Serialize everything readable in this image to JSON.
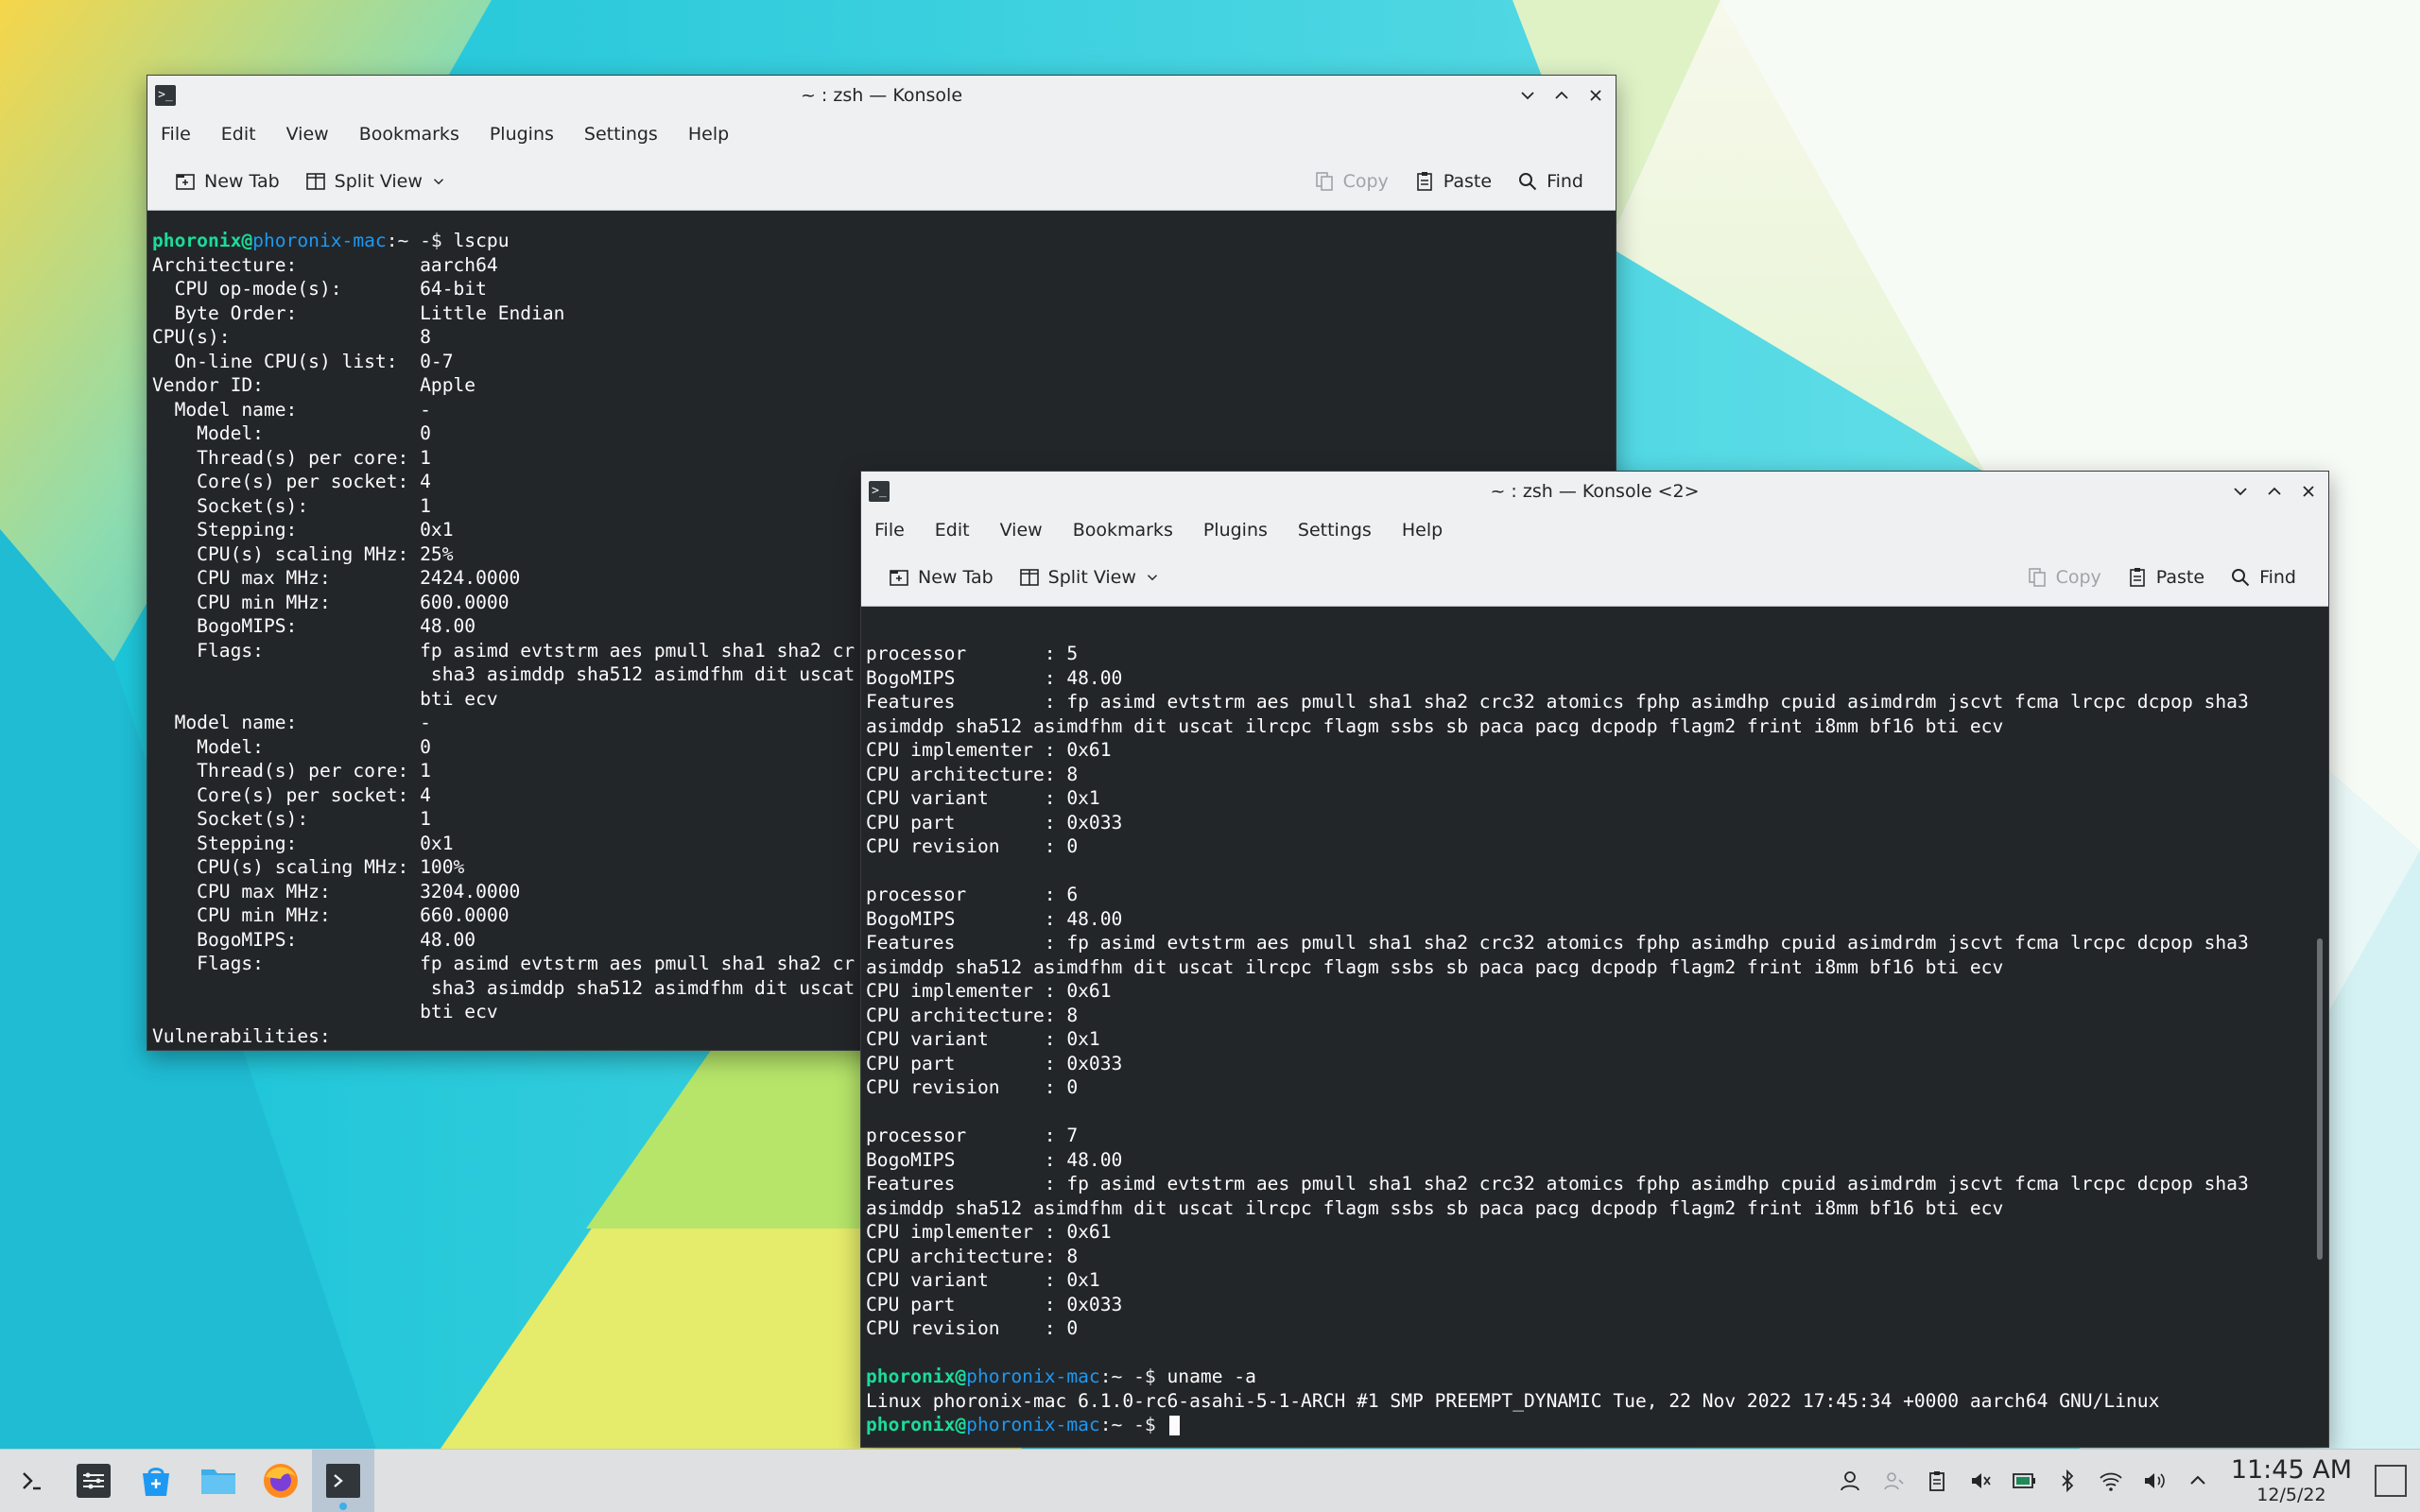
{
  "window1": {
    "title": "~ : zsh — Konsole",
    "menu": [
      "File",
      "Edit",
      "View",
      "Bookmarks",
      "Plugins",
      "Settings",
      "Help"
    ],
    "toolbar": {
      "new_tab": "New Tab",
      "split_view": "Split View",
      "copy": "Copy",
      "paste": "Paste",
      "find": "Find"
    },
    "lines": [
      {
        "prompt": true,
        "user": "phoronix",
        "host": "phoronix-mac",
        "dir": "~",
        "sym": " -$ ",
        "cmd": "lscpu"
      },
      {
        "text": "Architecture:           aarch64"
      },
      {
        "text": "  CPU op-mode(s):       64-bit"
      },
      {
        "text": "  Byte Order:           Little Endian"
      },
      {
        "text": "CPU(s):                 8"
      },
      {
        "text": "  On-line CPU(s) list:  0-7"
      },
      {
        "text": "Vendor ID:              Apple"
      },
      {
        "text": "  Model name:           -"
      },
      {
        "text": "    Model:              0"
      },
      {
        "text": "    Thread(s) per core: 1"
      },
      {
        "text": "    Core(s) per socket: 4"
      },
      {
        "text": "    Socket(s):          1"
      },
      {
        "text": "    Stepping:           0x1"
      },
      {
        "text": "    CPU(s) scaling MHz: 25%"
      },
      {
        "text": "    CPU max MHz:        2424.0000"
      },
      {
        "text": "    CPU min MHz:        600.0000"
      },
      {
        "text": "    BogoMIPS:           48.00"
      },
      {
        "text": "    Flags:              fp asimd evtstrm aes pmull sha1 sha2 cr"
      },
      {
        "text": "                         sha3 asimddp sha512 asimdfhm dit uscat"
      },
      {
        "text": "                        bti ecv"
      },
      {
        "text": "  Model name:           -"
      },
      {
        "text": "    Model:              0"
      },
      {
        "text": "    Thread(s) per core: 1"
      },
      {
        "text": "    Core(s) per socket: 4"
      },
      {
        "text": "    Socket(s):          1"
      },
      {
        "text": "    Stepping:           0x1"
      },
      {
        "text": "    CPU(s) scaling MHz: 100%"
      },
      {
        "text": "    CPU max MHz:        3204.0000"
      },
      {
        "text": "    CPU min MHz:        660.0000"
      },
      {
        "text": "    BogoMIPS:           48.00"
      },
      {
        "text": "    Flags:              fp asimd evtstrm aes pmull sha1 sha2 cr"
      },
      {
        "text": "                         sha3 asimddp sha512 asimdfhm dit uscat"
      },
      {
        "text": "                        bti ecv"
      },
      {
        "text": "Vulnerabilities:"
      }
    ]
  },
  "window2": {
    "title": "~ : zsh — Konsole <2>",
    "menu": [
      "File",
      "Edit",
      "View",
      "Bookmarks",
      "Plugins",
      "Settings",
      "Help"
    ],
    "toolbar": {
      "new_tab": "New Tab",
      "split_view": "Split View",
      "copy": "Copy",
      "paste": "Paste",
      "find": "Find"
    },
    "lines": [
      {
        "text": "processor       : 5"
      },
      {
        "text": "BogoMIPS        : 48.00"
      },
      {
        "text": "Features        : fp asimd evtstrm aes pmull sha1 sha2 crc32 atomics fphp asimdhp cpuid asimdrdm jscvt fcma lrcpc dcpop sha3"
      },
      {
        "text": "asimddp sha512 asimdfhm dit uscat ilrcpc flagm ssbs sb paca pacg dcpodp flagm2 frint i8mm bf16 bti ecv"
      },
      {
        "text": "CPU implementer : 0x61"
      },
      {
        "text": "CPU architecture: 8"
      },
      {
        "text": "CPU variant     : 0x1"
      },
      {
        "text": "CPU part        : 0x033"
      },
      {
        "text": "CPU revision    : 0"
      },
      {
        "text": ""
      },
      {
        "text": "processor       : 6"
      },
      {
        "text": "BogoMIPS        : 48.00"
      },
      {
        "text": "Features        : fp asimd evtstrm aes pmull sha1 sha2 crc32 atomics fphp asimdhp cpuid asimdrdm jscvt fcma lrcpc dcpop sha3"
      },
      {
        "text": "asimddp sha512 asimdfhm dit uscat ilrcpc flagm ssbs sb paca pacg dcpodp flagm2 frint i8mm bf16 bti ecv"
      },
      {
        "text": "CPU implementer : 0x61"
      },
      {
        "text": "CPU architecture: 8"
      },
      {
        "text": "CPU variant     : 0x1"
      },
      {
        "text": "CPU part        : 0x033"
      },
      {
        "text": "CPU revision    : 0"
      },
      {
        "text": ""
      },
      {
        "text": "processor       : 7"
      },
      {
        "text": "BogoMIPS        : 48.00"
      },
      {
        "text": "Features        : fp asimd evtstrm aes pmull sha1 sha2 crc32 atomics fphp asimdhp cpuid asimdrdm jscvt fcma lrcpc dcpop sha3"
      },
      {
        "text": "asimddp sha512 asimdfhm dit uscat ilrcpc flagm ssbs sb paca pacg dcpodp flagm2 frint i8mm bf16 bti ecv"
      },
      {
        "text": "CPU implementer : 0x61"
      },
      {
        "text": "CPU architecture: 8"
      },
      {
        "text": "CPU variant     : 0x1"
      },
      {
        "text": "CPU part        : 0x033"
      },
      {
        "text": "CPU revision    : 0"
      },
      {
        "text": ""
      },
      {
        "prompt": true,
        "user": "phoronix",
        "host": "phoronix-mac",
        "dir": "~",
        "sym": " -$ ",
        "cmd": "uname -a"
      },
      {
        "text": "Linux phoronix-mac 6.1.0-rc6-asahi-5-1-ARCH #1 SMP PREEMPT_DYNAMIC Tue, 22 Nov 2022 17:45:34 +0000 aarch64 GNU/Linux"
      },
      {
        "prompt": true,
        "user": "phoronix",
        "host": "phoronix-mac",
        "dir": "~",
        "sym": " -$ ",
        "cmd": "",
        "cursor": true
      }
    ]
  },
  "taskbar": {
    "items": [
      "application-launcher-icon",
      "pager-icon",
      "discover-icon",
      "dolphin-icon",
      "firefox-icon",
      "konsole-icon"
    ],
    "tray": [
      "user-icon",
      "network-users-icon",
      "clipboard-icon",
      "audio-muted-icon",
      "battery-icon",
      "bluetooth-icon",
      "wifi-icon",
      "volume-icon",
      "expand-tray-icon"
    ],
    "time": "11:45 AM",
    "date": "12/5/22"
  },
  "colors": {
    "terminal_bg": "#232629",
    "prompt_user": "#1cdc9a",
    "prompt_host": "#1d99f3",
    "accent": "#3daee9"
  }
}
